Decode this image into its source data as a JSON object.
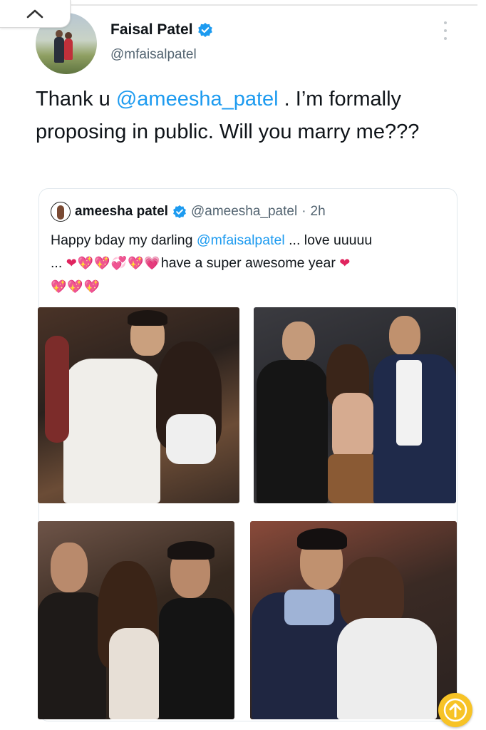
{
  "tweet": {
    "author_name": "Faisal Patel",
    "author_handle": "@mfaisalpatel",
    "text_part1": "Thank u ",
    "mention": "@ameesha_patel",
    "text_part2": " . I’m formally proposing in public. Will you marry me???",
    "verified_icon": "verified-badge-icon",
    "more_icon": "more-vertical-icon"
  },
  "quoted_tweet": {
    "author_name": "ameesha patel",
    "author_handle": "@ameesha_patel",
    "separator": " · ",
    "time": "2h",
    "text_part1": "Happy bday my darling ",
    "mention": "@mfaisalpatel",
    "text_part2": " ... love uuuuu",
    "text_part3": "...",
    "emoji_row1": "❤💖💖💞💖💗",
    "text_part4": "have a super awesome year",
    "emoji_heart": "❤",
    "emoji_row2": "💖💖💖"
  },
  "ui": {
    "collapse_icon": "chevron-up-icon",
    "scroll_top_icon": "arrow-up-icon",
    "accent_color": "#1d9bf0",
    "scroll_button_color": "#f7c326"
  }
}
